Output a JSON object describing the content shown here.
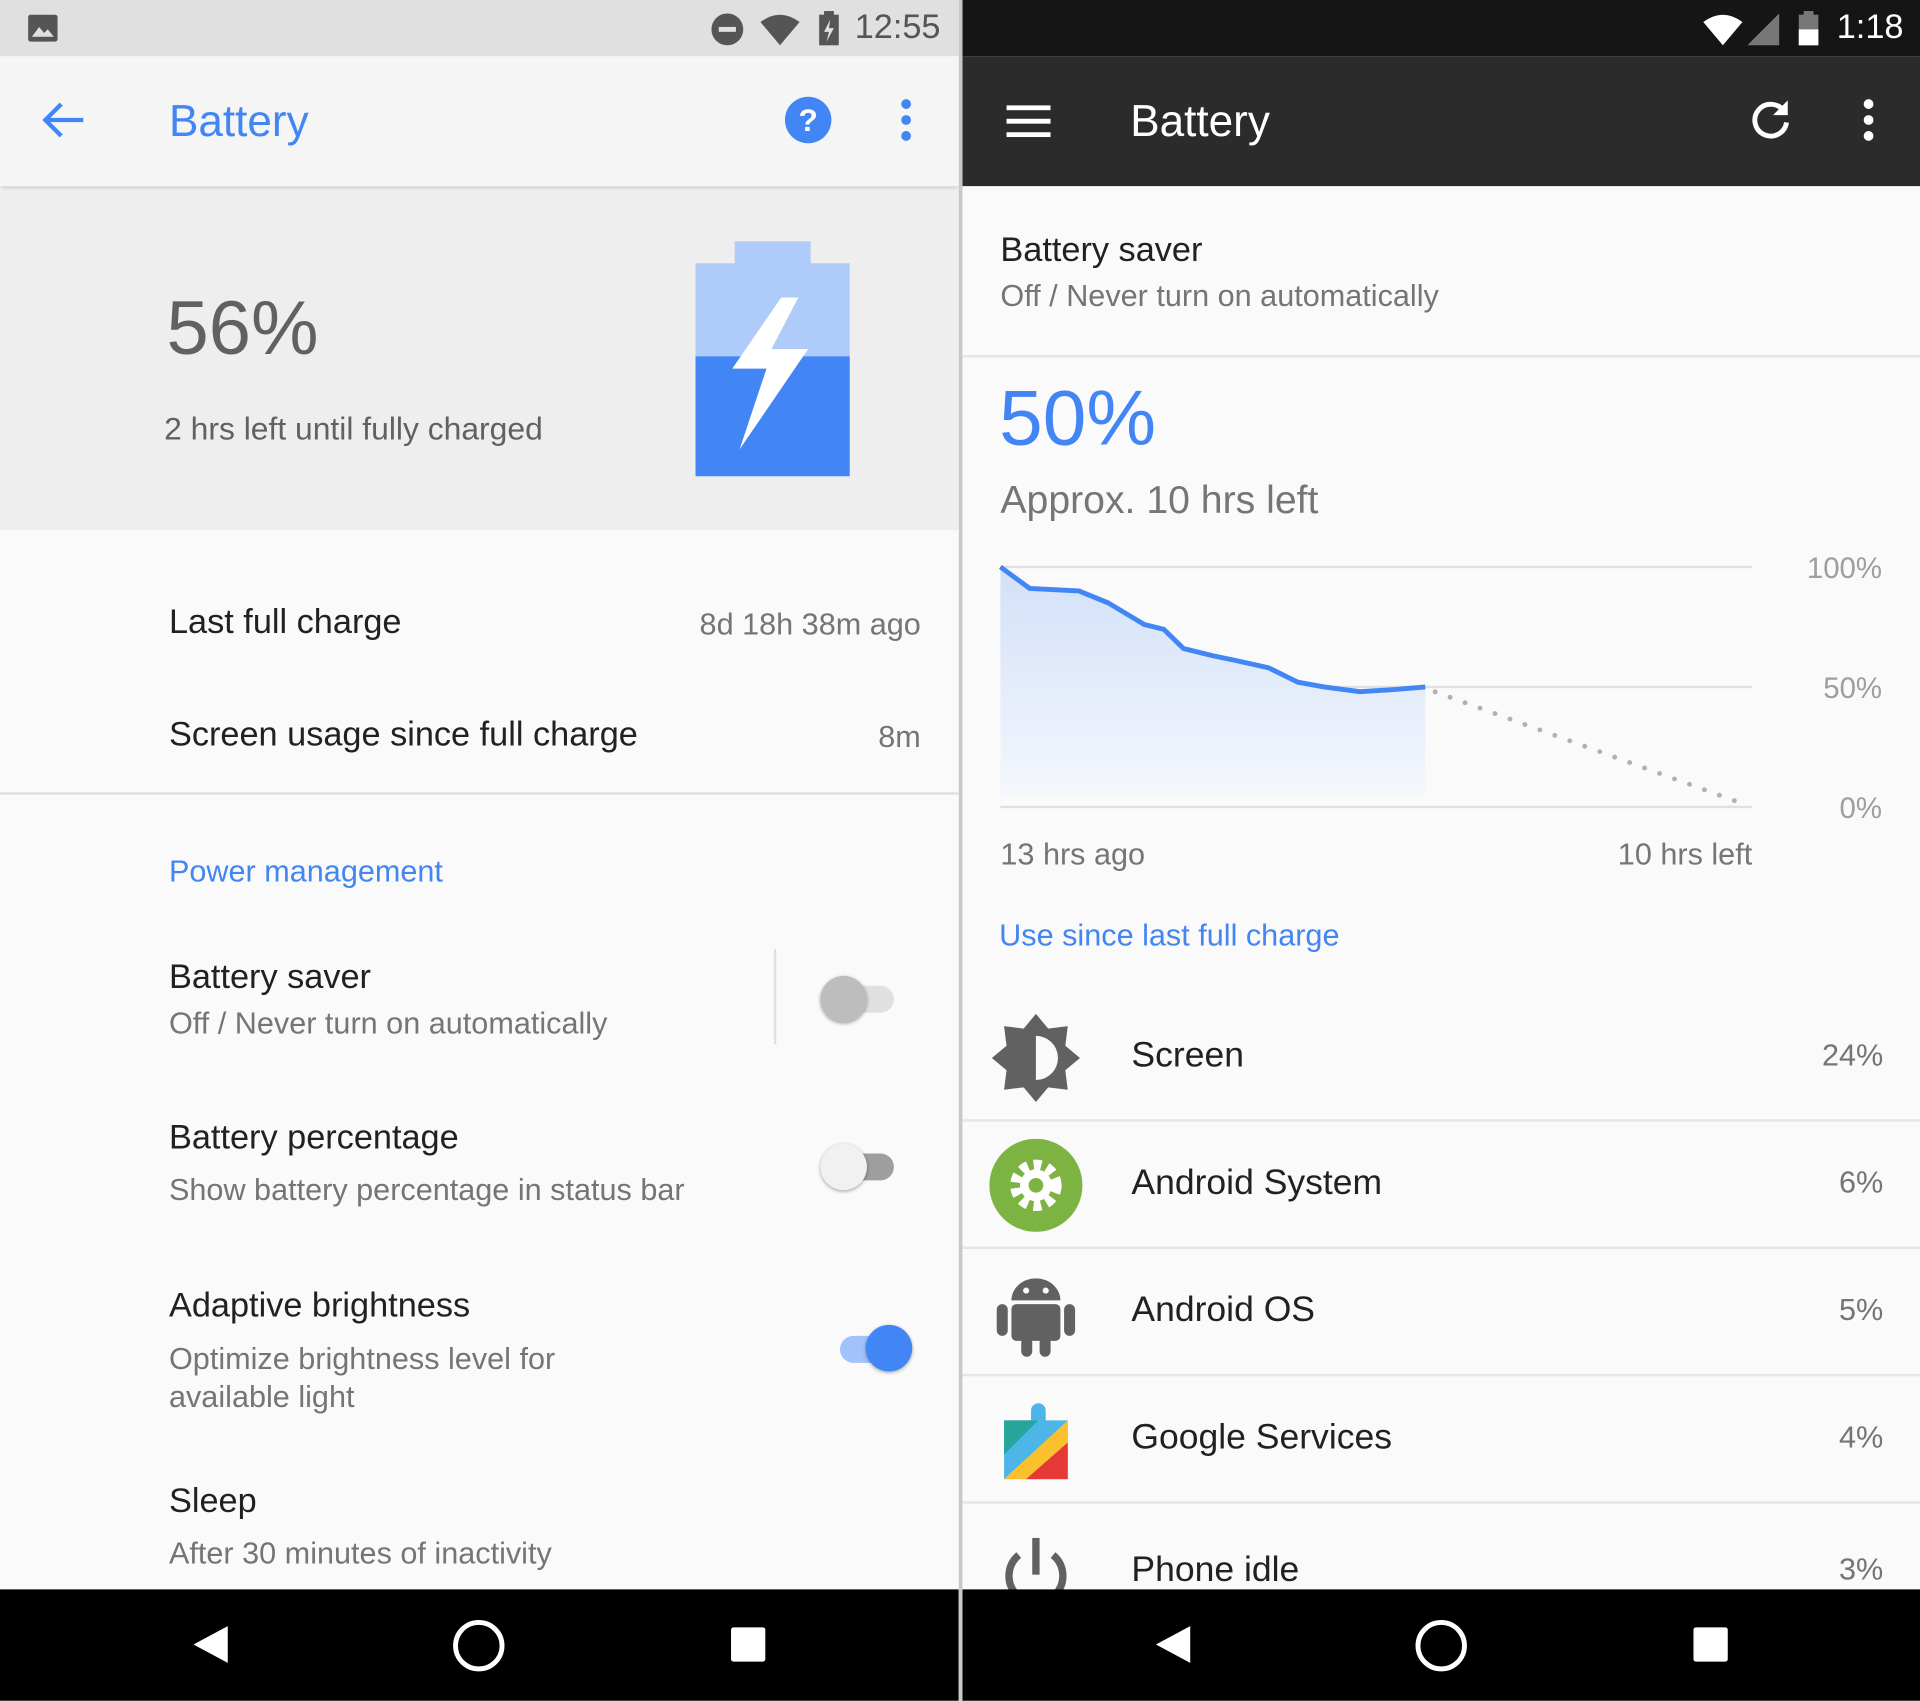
{
  "left": {
    "status_bar": {
      "time": "12:55",
      "icons": [
        "image-icon",
        "do-not-disturb-icon",
        "wifi-icon",
        "battery-charging-icon"
      ]
    },
    "toolbar": {
      "title": "Battery",
      "icons": [
        "back-arrow-icon",
        "help-icon",
        "more-vert-icon"
      ]
    },
    "header": {
      "percent": "56%",
      "status": "2 hrs left until fully charged",
      "battery_level": 56,
      "icon": "battery-charging-icon"
    },
    "stats": [
      {
        "label": "Last full charge",
        "value": "8d 18h 38m ago"
      },
      {
        "label": "Screen usage since full charge",
        "value": "8m"
      }
    ],
    "section_title": "Power management",
    "settings": [
      {
        "title": "Battery saver",
        "summary": "Off / Never turn on automatically",
        "on": false
      },
      {
        "title": "Battery percentage",
        "summary": "Show battery percentage in status bar",
        "on": false
      },
      {
        "title": "Adaptive brightness",
        "summary": "Optimize brightness level for available light",
        "on": true
      },
      {
        "title": "Sleep",
        "summary": "After 30 minutes of inactivity"
      }
    ],
    "accent": "#4285f4"
  },
  "right": {
    "status_bar": {
      "time": "1:18",
      "icons": [
        "wifi-icon",
        "cell-signal-icon",
        "battery-icon"
      ]
    },
    "toolbar": {
      "title": "Battery",
      "icons": [
        "menu-icon",
        "refresh-icon",
        "more-vert-icon"
      ]
    },
    "battery_saver": {
      "title": "Battery saver",
      "summary": "Off / Never turn on automatically"
    },
    "percent": "50%",
    "estimate": "Approx. 10 hrs left",
    "section_title": "Use since last full charge",
    "usage": [
      {
        "name": "Screen",
        "percent": "24%",
        "icon": "brightness-icon"
      },
      {
        "name": "Android System",
        "percent": "6%",
        "icon": "android-system-gear-icon"
      },
      {
        "name": "Android OS",
        "percent": "5%",
        "icon": "android-robot-icon"
      },
      {
        "name": "Google Services",
        "percent": "4%",
        "icon": "google-play-services-icon"
      },
      {
        "name": "Phone idle",
        "percent": "3%",
        "icon": "power-icon"
      }
    ]
  },
  "chart_data": {
    "type": "area",
    "x_unit": "hours relative to now",
    "xlim": [
      -13,
      10
    ],
    "ylim": [
      0,
      100
    ],
    "x_tick_labels": [
      "13 hrs ago",
      "10 hrs left"
    ],
    "y_tick_labels": [
      "100%",
      "50%",
      "0%"
    ],
    "grid": true,
    "series": [
      {
        "kind": "history",
        "style": "solid",
        "color": "#4285f4",
        "x": [
          -13,
          -12.1,
          -10.6,
          -9.7,
          -8.6,
          -8.0,
          -7.4,
          -6.5,
          -5.8,
          -4.8,
          -3.9,
          -3.1,
          -2.0,
          -0.9,
          0
        ],
        "y": [
          100,
          91,
          90,
          85,
          76,
          74,
          66,
          63,
          61,
          58,
          52,
          50,
          48,
          49,
          50
        ]
      },
      {
        "kind": "projection",
        "style": "dotted",
        "color": "#9e9e9e",
        "x": [
          0,
          10
        ],
        "y": [
          50,
          0
        ]
      }
    ]
  },
  "nav": {
    "icons": [
      "back-icon",
      "home-icon",
      "recents-icon"
    ]
  }
}
